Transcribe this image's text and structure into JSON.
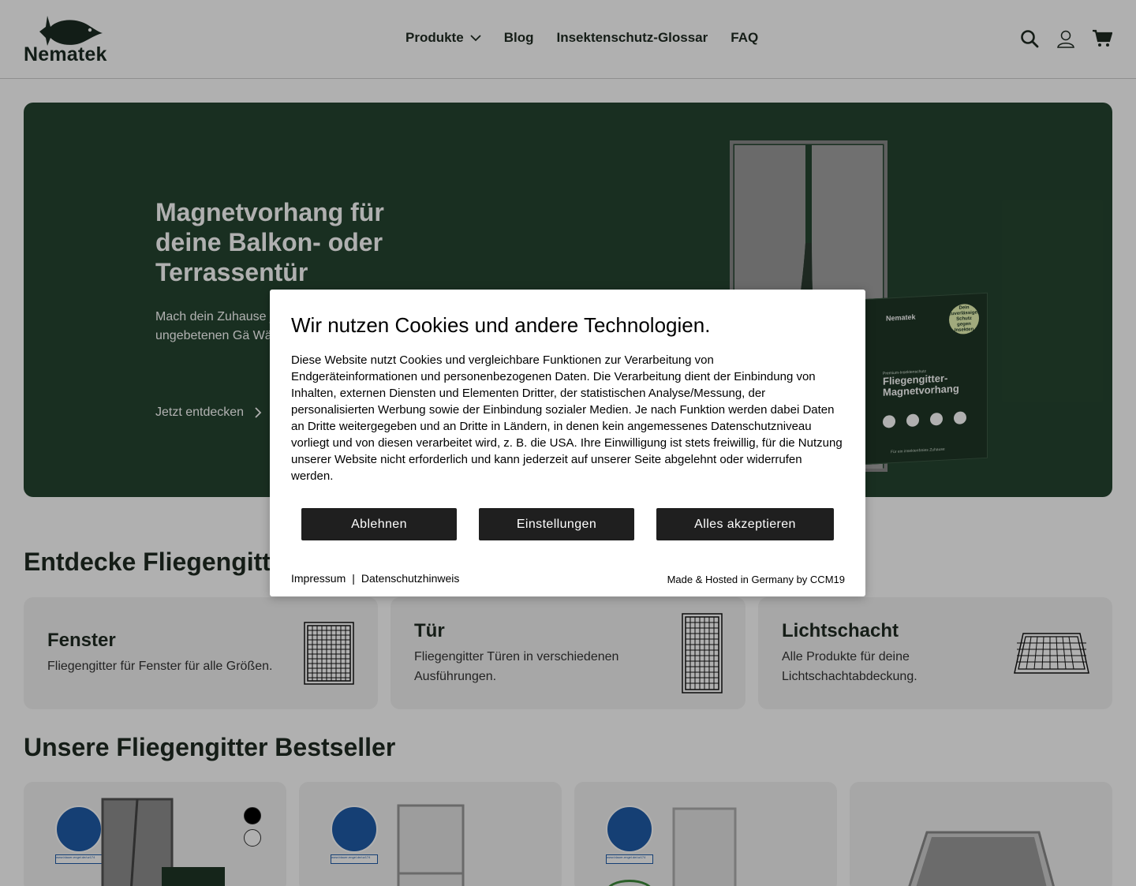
{
  "brand": {
    "name": "Nematek",
    "accent": "#254530"
  },
  "nav": {
    "items": [
      "Produkte",
      "Blog",
      "Insektenschutz-Glossar",
      "FAQ"
    ]
  },
  "header_icons": [
    "search-icon",
    "user-icon",
    "cart-icon"
  ],
  "hero": {
    "title": "Magnetvorhang für deine Balkon- oder Terrassentür",
    "text": "Mach dein Zuhause jetzt deinen Magnet vor ungebetenen Gä Wänden.",
    "cta": "Jetzt entdecken",
    "box_brand": "Nematek",
    "box_sub": "Premium-Insektenschutz",
    "box_title": "Fliegengitter-Magnetvorhang",
    "box_badge": "Dein zuverlässiger Schutz gegen Insekten",
    "box_footer": "Für ein insektenfreies Zuhause"
  },
  "sections": {
    "discover": "Entdecke Fliegengitt",
    "bestseller": "Unsere Fliegengitter Bestseller"
  },
  "categories": [
    {
      "title": "Fenster",
      "text": "Fliegengitter für Fenster für alle Größen."
    },
    {
      "title": "Tür",
      "text": "Fliegengitter Türen in verschiedenen Ausführungen."
    },
    {
      "title": "Lichtschacht",
      "text": "Alle Produkte für deine Lichtschachtabdeckung."
    }
  ],
  "product_badges": {
    "angel_label": "www.blauer-engel.de/uz174"
  },
  "cookie": {
    "title": "Wir nutzen Cookies und andere Technologien.",
    "text": "Diese Website nutzt Cookies und vergleichbare Funktionen zur Verarbeitung von Endgeräteinformationen und personenbezogenen Daten. Die Verarbeitung dient der Einbindung von Inhalten, externen Diensten und Elementen Dritter, der statistischen Analyse/Messung, der personalisierten Werbung sowie der Einbindung sozialer Medien. Je nach Funktion werden dabei Daten an Dritte weitergegeben und an Dritte in Ländern, in denen kein angemessenes Datenschutzniveau vorliegt und von diesen verarbeitet wird, z. B. die USA. Ihre Einwilligung ist stets freiwillig, für die Nutzung unserer Website nicht erforderlich und kann jederzeit auf unserer Seite abgelehnt oder widerrufen werden.",
    "decline": "Ablehnen",
    "settings": "Einstellungen",
    "accept": "Alles akzeptieren",
    "imprint": "Impressum",
    "separator": "|",
    "privacy": "Datenschutzhinweis",
    "made": "Made & Hosted in Germany by CCM19"
  }
}
